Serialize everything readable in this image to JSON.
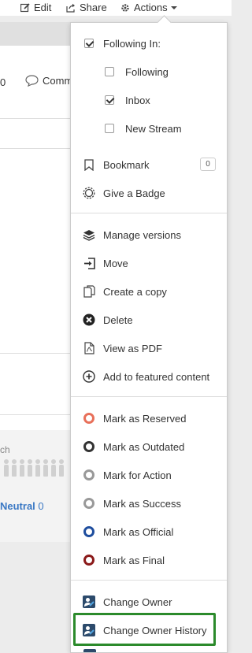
{
  "topbar": {
    "edit_label": "Edit",
    "share_label": "Share",
    "actions_label": "Actions"
  },
  "background": {
    "partial_count": "0",
    "comment_label": "Comm",
    "search_partial": "ch",
    "neutral_label": "Neutral",
    "neutral_count": "0"
  },
  "menu": {
    "following_in": "Following In:",
    "following": "Following",
    "inbox": "Inbox",
    "new_stream": "New Stream",
    "bookmark": "Bookmark",
    "bookmark_count": "0",
    "give_badge": "Give a Badge",
    "manage_versions": "Manage versions",
    "move": "Move",
    "create_copy": "Create a copy",
    "delete": "Delete",
    "view_pdf": "View as PDF",
    "add_featured": "Add to featured content",
    "mark_reserved": "Mark as Reserved",
    "mark_outdated": "Mark as Outdated",
    "mark_action": "Mark for Action",
    "mark_success": "Mark as Success",
    "mark_official": "Mark as Official",
    "mark_final": "Mark as Final",
    "change_owner": "Change Owner",
    "change_owner_history": "Change Owner History"
  },
  "colors": {
    "reserved": "#e8705a",
    "outdated": "#333333",
    "action": "#999999",
    "success": "#999999",
    "official": "#1f4e9e",
    "final": "#8b1a1a",
    "highlight": "#2b8a2b",
    "link": "#3a78c4"
  }
}
